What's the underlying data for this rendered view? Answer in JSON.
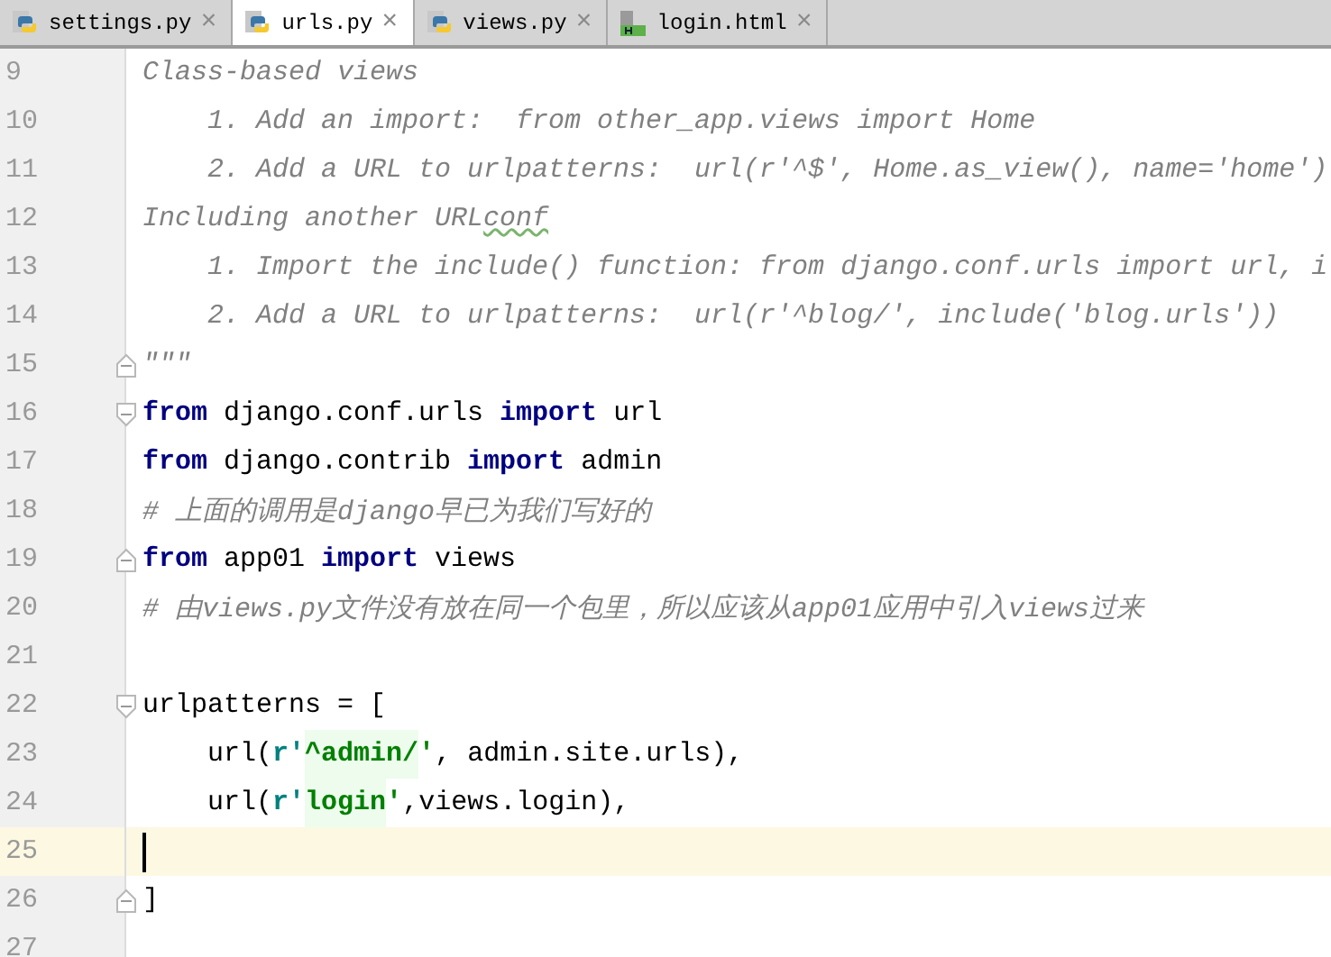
{
  "tabs": [
    {
      "label": "settings.py",
      "kind": "python",
      "selected": false,
      "close": "×"
    },
    {
      "label": "urls.py",
      "kind": "python",
      "selected": true,
      "close": "×"
    },
    {
      "label": "views.py",
      "kind": "python",
      "selected": false,
      "close": "×"
    },
    {
      "label": "login.html",
      "kind": "html",
      "selected": false,
      "close": "×"
    }
  ],
  "editor": {
    "lines": [
      {
        "number": "9",
        "current": false,
        "kind": "plain",
        "tokens": [
          {
            "kind": "comment",
            "text": "Class-based views"
          }
        ]
      },
      {
        "number": "10",
        "current": false,
        "kind": "plain",
        "tokens": [
          {
            "kind": "comment",
            "text": "    1. Add an import:  from other_app.views import Home"
          }
        ]
      },
      {
        "number": "11",
        "current": false,
        "kind": "plain",
        "tokens": [
          {
            "kind": "comment",
            "text": "    2. Add a URL to urlpatterns:  url(r'^$', Home.as_view(), name='home')"
          }
        ]
      },
      {
        "number": "12",
        "current": false,
        "kind": "plain",
        "tokens": [
          {
            "kind": "comment",
            "text": "Including another URL"
          },
          {
            "kind": "typo",
            "text": "conf"
          }
        ]
      },
      {
        "number": "13",
        "current": false,
        "kind": "plain",
        "tokens": [
          {
            "kind": "comment",
            "text": "    1. Import the include() function: from django.conf.urls import url, i"
          }
        ]
      },
      {
        "number": "14",
        "current": false,
        "kind": "plain",
        "tokens": [
          {
            "kind": "comment",
            "text": "    2. Add a URL to urlpatterns:  url(r'^blog/', include('blog.urls'))"
          }
        ]
      },
      {
        "number": "15",
        "current": false,
        "kind": "fold_end",
        "tokens": [
          {
            "kind": "comment",
            "text": "\"\"\""
          }
        ]
      },
      {
        "number": "16",
        "current": false,
        "kind": "fold_start",
        "tokens": [
          {
            "kind": "keyword",
            "text": "from"
          },
          {
            "kind": "plain",
            "text": " django.conf.urls "
          },
          {
            "kind": "keyword",
            "text": "import"
          },
          {
            "kind": "plain",
            "text": " url"
          }
        ]
      },
      {
        "number": "17",
        "current": false,
        "kind": "plain",
        "tokens": [
          {
            "kind": "keyword",
            "text": "from"
          },
          {
            "kind": "plain",
            "text": " django.contrib "
          },
          {
            "kind": "keyword",
            "text": "import"
          },
          {
            "kind": "plain",
            "text": " admin"
          }
        ]
      },
      {
        "number": "18",
        "current": false,
        "kind": "plain",
        "tokens": [
          {
            "kind": "comment",
            "text": "# 上面的调用是django早已为我们写好的"
          }
        ]
      },
      {
        "number": "19",
        "current": false,
        "kind": "fold_end",
        "tokens": [
          {
            "kind": "keyword",
            "text": "from"
          },
          {
            "kind": "plain",
            "text": " app01 "
          },
          {
            "kind": "keyword",
            "text": "import"
          },
          {
            "kind": "plain",
            "text": " views"
          }
        ]
      },
      {
        "number": "20",
        "current": false,
        "kind": "plain",
        "tokens": [
          {
            "kind": "comment",
            "text": "# 由views.py文件没有放在同一个包里，所以应该从app01应用中引入views过来"
          }
        ]
      },
      {
        "number": "21",
        "current": false,
        "kind": "plain"
      },
      {
        "number": "22",
        "current": false,
        "kind": "fold_start",
        "tokens": [
          {
            "kind": "plain",
            "text": "urlpatterns = ["
          }
        ]
      },
      {
        "number": "23",
        "current": false,
        "kind": "plain",
        "tokens": [
          {
            "kind": "plain",
            "text": "    url("
          },
          {
            "kind": "prefix",
            "text": "r'"
          },
          {
            "kind": "string",
            "text": "^admin/"
          },
          {
            "kind": "quote",
            "text": "'"
          },
          {
            "kind": "plain",
            "text": ", admin.site.urls),"
          }
        ]
      },
      {
        "number": "24",
        "current": false,
        "kind": "plain",
        "tokens": [
          {
            "kind": "plain",
            "text": "    url("
          },
          {
            "kind": "prefix",
            "text": "r'"
          },
          {
            "kind": "string",
            "text": "login"
          },
          {
            "kind": "quote",
            "text": "'"
          },
          {
            "kind": "plain",
            "text": ",views.login),"
          }
        ]
      },
      {
        "number": "25",
        "current": true,
        "kind": "plain"
      },
      {
        "number": "26",
        "current": false,
        "kind": "fold_end",
        "tokens": [
          {
            "kind": "plain",
            "text": "]"
          }
        ]
      },
      {
        "number": "27",
        "current": false,
        "kind": "plain"
      }
    ]
  }
}
